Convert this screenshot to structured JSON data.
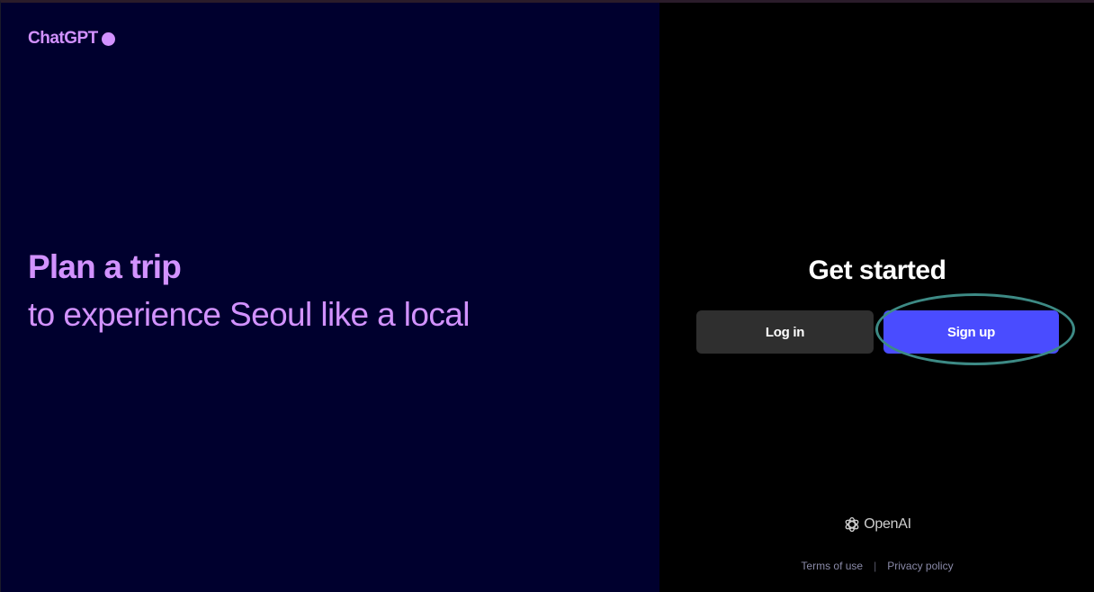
{
  "brand": {
    "name": "ChatGPT",
    "dot_icon": "circle-dot-icon",
    "color": "#d292ff"
  },
  "hero": {
    "headline": "Plan a trip",
    "subline": "to experience Seoul like a local"
  },
  "auth": {
    "title": "Get started",
    "login_label": "Log in",
    "signup_label": "Sign up",
    "signup_color": "#4a4cff",
    "login_color": "#2f2f2f"
  },
  "footer": {
    "company": "OpenAI",
    "company_icon": "openai-logo-icon",
    "terms": "Terms of use",
    "separator": "|",
    "privacy": "Privacy policy"
  },
  "colors": {
    "left_panel": "#00002e",
    "right_panel": "#000000",
    "highlight_ring": "#3d8a85"
  }
}
